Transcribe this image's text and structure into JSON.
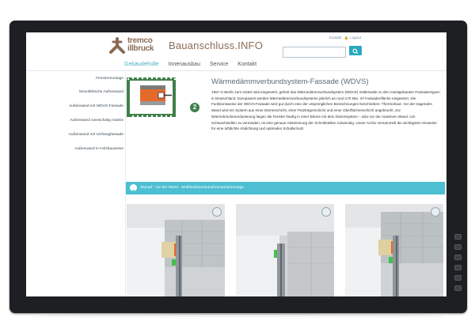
{
  "site": {
    "logo_line1": "tremco",
    "logo_line2": "illbruck",
    "title": "Bauanschluss.INFO"
  },
  "top_links": {
    "contact": "Kontakt",
    "login": "Logout"
  },
  "search": {
    "placeholder": ""
  },
  "nav": [
    {
      "label": "Gebäudehülle",
      "active": true
    },
    {
      "label": "Innenausbau",
      "active": false
    },
    {
      "label": "Service",
      "active": false
    },
    {
      "label": "Kontakt",
      "active": false
    }
  ],
  "sidebar": [
    {
      "label": "Fenstermontage"
    },
    {
      "label": "Monolithische Außenwand"
    },
    {
      "label": "Außenwand mit WDVS-Fassade"
    },
    {
      "label": "Außenwand zweischalig massiv"
    },
    {
      "label": "Außenwand mit Vorhangfassade"
    },
    {
      "label": "Außenwand in Holzbauweise"
    }
  ],
  "content": {
    "thumb_badge": "2",
    "heading": "Wärmedämmverbundsystem-Fassade (WDVS)",
    "body": "1957 in Berlin zum ersten Mal eingesetzt, gehört das Wärmedämmverbundsystem (WDVS) mittlerweile zu den meistgebauten Fassadentypen in Deutschland. Europaweit werden Wärmedämmverbundsysteme jährlich an rund 170 Mio. m² Fassadenfläche eingesetzt. Die Funktionsweise der WDVS-Fassade wird gut durch eine der ursprünglichen Bezeichnungen beschrieben: Thermohaut. Vor der tragenden Wand wird ein System aus einer Dämmschicht, einer Putzträgerschicht und einer Oberflächenschicht angebracht. Zur Wärmebrückenreduzierung liegen die Fenster häufig in einer Ebene mit dem Dämmsystem – also vor der massiven Wand. Um Schwachstellen zu vermeiden, ist eine genaue Abstimmung der Schnittstellen notwendig. Unser Archiv versammelt die wichtigsten Hinweise für eine luftdichte Abdichtung und optimalen Schallschutz.",
    "accordion_label": "Stumpf - vor der Wand - Multifunktionsband/Vorwandmontage"
  },
  "colors": {
    "accent": "#4dbfd2",
    "brand_brown": "#8b6c58",
    "thumb_green": "#3f7f4a",
    "highlight_orange": "#e46a2b",
    "seal_green": "#3fc24a"
  }
}
